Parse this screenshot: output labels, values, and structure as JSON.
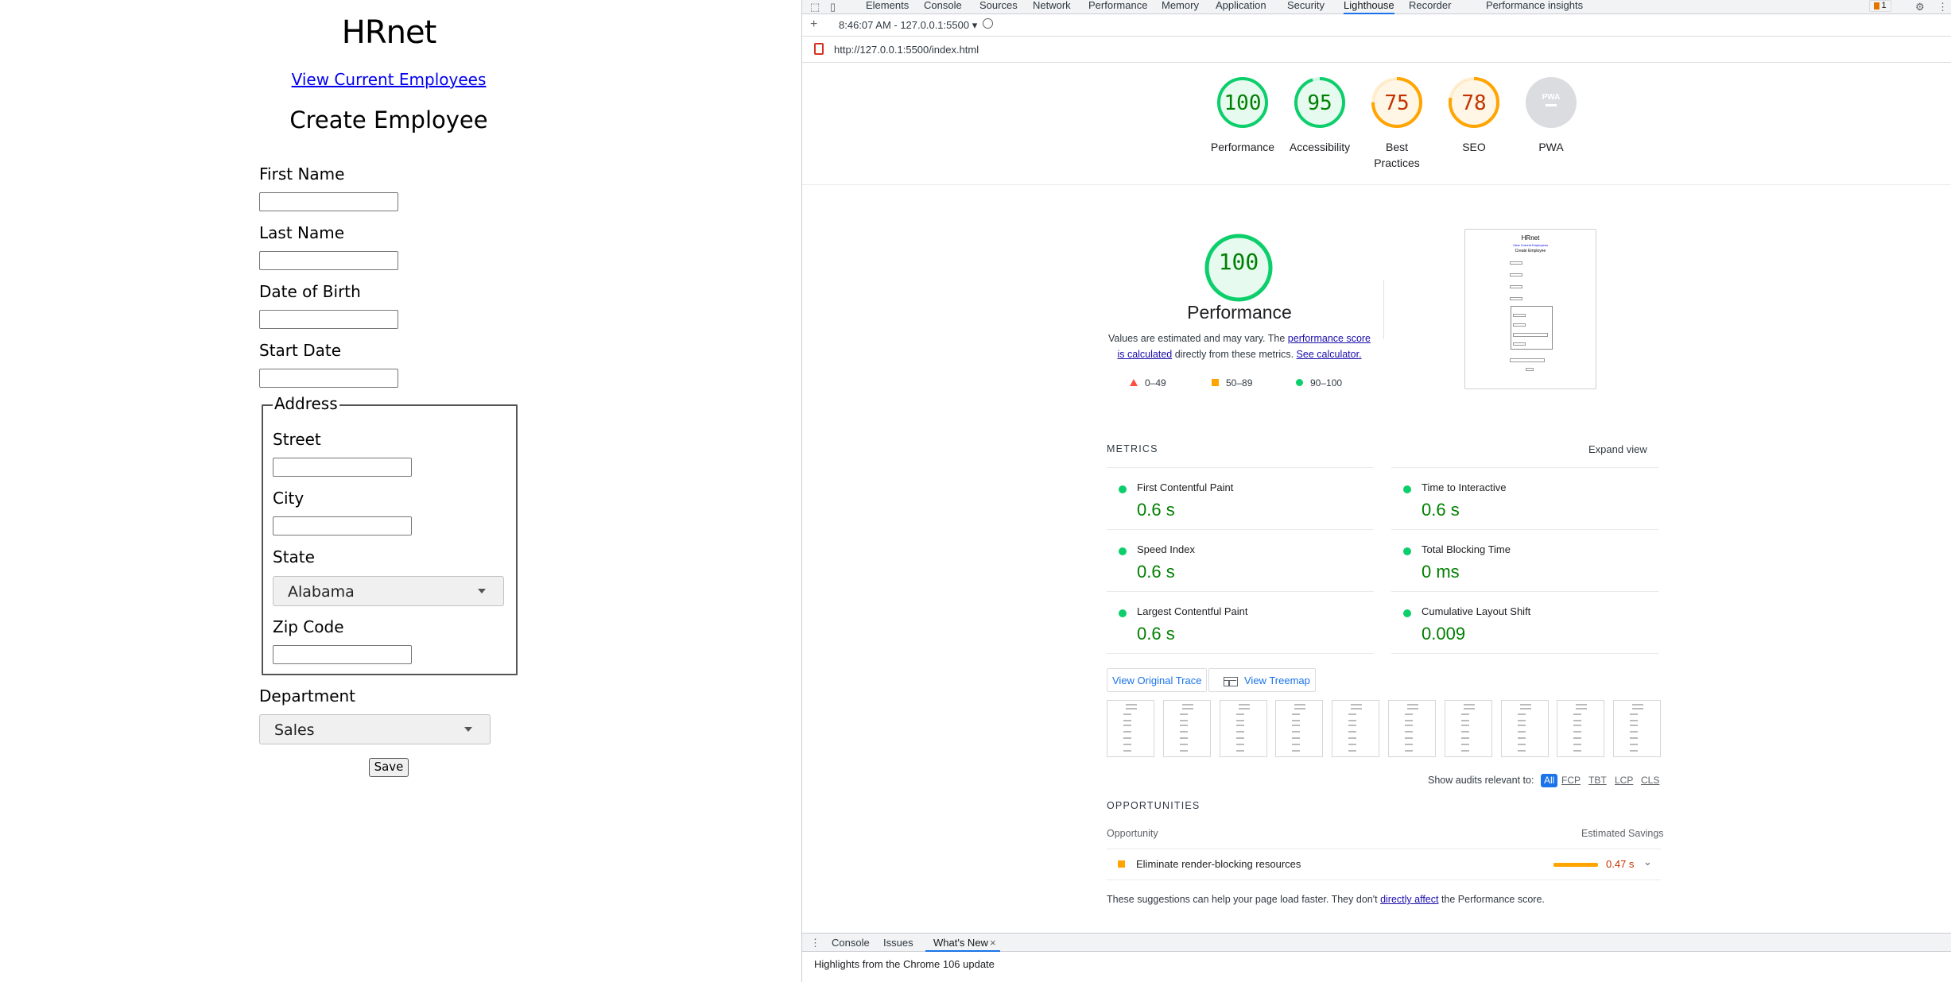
{
  "hrnet": {
    "title": "HRnet",
    "view_link": "View Current Employees",
    "subtitle": "Create Employee",
    "fields": {
      "first_name": "First Name",
      "last_name": "Last Name",
      "dob": "Date of Birth",
      "start_date": "Start Date",
      "address_legend": "Address",
      "street": "Street",
      "city": "City",
      "state": "State",
      "zip": "Zip Code",
      "department": "Department"
    },
    "state_value": "Alabama",
    "department_value": "Sales",
    "save_label": "Save"
  },
  "devtools": {
    "tabs": [
      "Elements",
      "Console",
      "Sources",
      "Network",
      "Performance",
      "Memory",
      "Application",
      "Security",
      "Lighthouse",
      "Recorder",
      "Performance insights"
    ],
    "active_tab": "Lighthouse",
    "issue_count": "1",
    "report_selector": "8:46:07 AM - 127.0.0.1:5500",
    "url": "http://127.0.0.1:5500/index.html",
    "gauges": [
      {
        "score": "100",
        "label": "Performance",
        "color": "#0cce6b",
        "text_color": "#008000",
        "fraction": 1.0
      },
      {
        "score": "95",
        "label": "Accessibility",
        "color": "#0cce6b",
        "text_color": "#008000",
        "fraction": 0.95
      },
      {
        "score": "75",
        "label": "Best Practices",
        "color": "#ffa400",
        "text_color": "#c33300",
        "fraction": 0.75
      },
      {
        "score": "78",
        "label": "SEO",
        "color": "#ffa400",
        "text_color": "#c33300",
        "fraction": 0.78
      },
      {
        "score": "PWA",
        "label": "PWA",
        "color": "#dadce0",
        "text_color": "#9aa0a6",
        "fraction": 1.0
      }
    ],
    "performance": {
      "score": "100",
      "fraction": 1.0,
      "title": "Performance",
      "desc_prefix": "Values are estimated and may vary. The ",
      "desc_link1": "performance score is calculated",
      "desc_mid": " directly from these metrics. ",
      "desc_link2": "See calculator.",
      "legend": [
        {
          "range": "0–49",
          "color": "#ff4e42",
          "shape": "triangle"
        },
        {
          "range": "50–89",
          "color": "#ffa400",
          "shape": "square"
        },
        {
          "range": "90–100",
          "color": "#0cce6b",
          "shape": "circle"
        }
      ],
      "thumb": {
        "title": "HRnet",
        "link": "View Current Employees",
        "subtitle": "Create Employee"
      }
    },
    "metrics_label": "METRICS",
    "expand_view": "Expand view",
    "metrics": [
      {
        "name": "First Contentful Paint",
        "value": "0.6 s"
      },
      {
        "name": "Time to Interactive",
        "value": "0.6 s"
      },
      {
        "name": "Speed Index",
        "value": "0.6 s"
      },
      {
        "name": "Total Blocking Time",
        "value": "0 ms"
      },
      {
        "name": "Largest Contentful Paint",
        "value": "0.6 s"
      },
      {
        "name": "Cumulative Layout Shift",
        "value": "0.009"
      }
    ],
    "view_trace": "View Original Trace",
    "view_treemap": "View Treemap",
    "show_audits": "Show audits relevant to:",
    "audit_filters": [
      "All",
      "FCP",
      "TBT",
      "LCP",
      "CLS"
    ],
    "opportunities_label": "OPPORTUNITIES",
    "opp_col1": "Opportunity",
    "opp_col2": "Estimated Savings",
    "opportunity": {
      "title": "Eliminate render-blocking resources",
      "savings": "0.47 s"
    },
    "footnote_prefix": "These suggestions can help your page load faster. They don't ",
    "footnote_link": "directly affect",
    "footnote_suffix": " the Performance score.",
    "drawer_tabs": [
      "Console",
      "Issues",
      "What's New"
    ],
    "drawer_active": "What's New",
    "drawer_text": "Highlights from the Chrome 106 update"
  }
}
